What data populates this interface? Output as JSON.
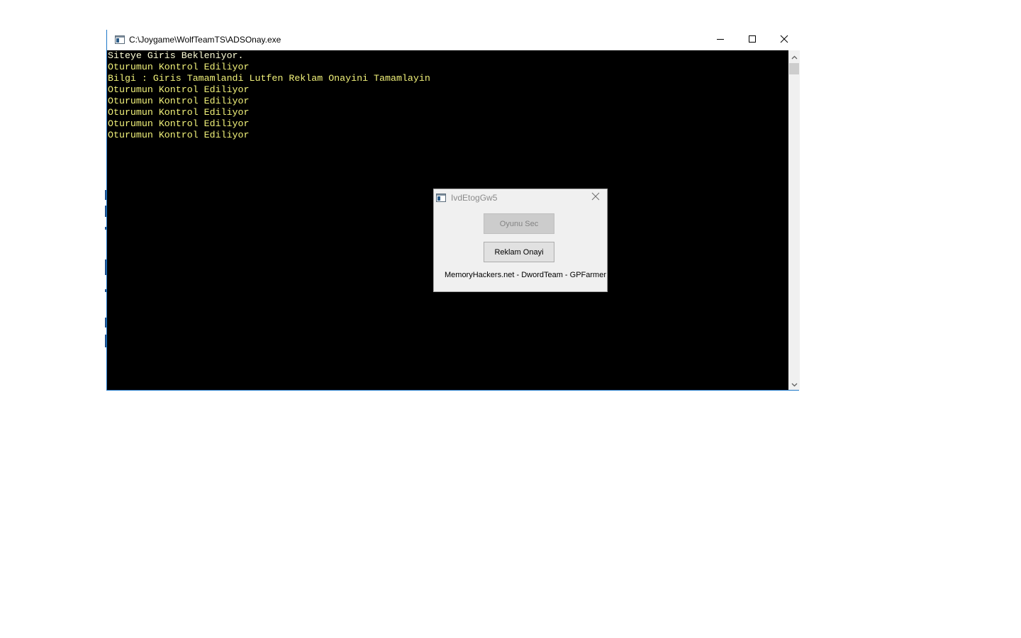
{
  "console": {
    "title": "C:\\Joygame\\WolfTeamTS\\ADSOnay.exe",
    "lines": [
      "Siteye Giris Bekleniyor.",
      "Oturumun Kontrol Ediliyor",
      "Bilgi : Giris Tamamlandi Lutfen Reklam Onayini Tamamlayin",
      "Oturumun Kontrol Ediliyor",
      "Oturumun Kontrol Ediliyor",
      "Oturumun Kontrol Ediliyor",
      "Oturumun Kontrol Ediliyor",
      "Oturumun Kontrol Ediliyor"
    ],
    "text_color": "#f2f27a",
    "background_color": "#000000"
  },
  "dialog": {
    "title": "IvdEtogGw5",
    "buttons": {
      "select_game": "Oyunu Sec",
      "ad_confirm": "Reklam Onayi"
    },
    "footer": "MemoryHackers.net - DwordTeam - GPFarmer"
  },
  "icons": {
    "console_app": "console-app-icon",
    "minimize": "minimize-icon",
    "maximize": "maximize-icon",
    "close": "close-icon",
    "scroll_up": "chevron-up-icon",
    "scroll_down": "chevron-down-icon"
  }
}
